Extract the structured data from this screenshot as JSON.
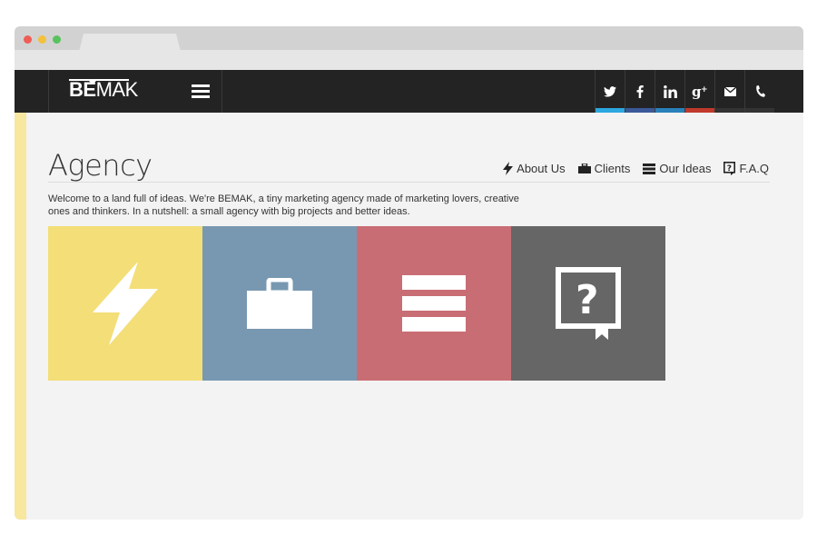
{
  "browser": {
    "window_controls": [
      "close",
      "minimize",
      "maximize"
    ]
  },
  "header": {
    "logo": {
      "be": "BE",
      "mak": "MAK"
    },
    "menu_icon": "hamburger-menu-icon",
    "social": [
      {
        "name": "twitter",
        "icon": "twitter-icon",
        "color": "#2ca7e0"
      },
      {
        "name": "facebook",
        "icon": "facebook-icon",
        "color": "#3b5998"
      },
      {
        "name": "linkedin",
        "icon": "linkedin-icon",
        "color": "#2a80b9"
      },
      {
        "name": "google-plus",
        "icon": "google-plus-icon",
        "color": "#c0392b"
      },
      {
        "name": "email",
        "icon": "mail-icon",
        "color": "#333333"
      },
      {
        "name": "phone",
        "icon": "phone-icon",
        "color": "#333333"
      }
    ]
  },
  "page": {
    "title": "Agency",
    "intro": "Welcome to a land full of ideas. We're BEMAK, a tiny marketing agency made of marketing lovers, creative ones and thinkers. In a nutshell: a small agency with big projects and better ideas.",
    "accent_color": "#f7e79f"
  },
  "subnav": [
    {
      "label": "About Us",
      "icon": "lightning-icon"
    },
    {
      "label": "Clients",
      "icon": "briefcase-icon"
    },
    {
      "label": "Our Ideas",
      "icon": "list-icon"
    },
    {
      "label": "F.A.Q",
      "icon": "question-icon"
    }
  ],
  "tiles": [
    {
      "name": "about",
      "icon": "lightning-icon",
      "color": "#f3de78"
    },
    {
      "name": "clients",
      "icon": "briefcase-icon",
      "color": "#7898b1"
    },
    {
      "name": "ideas",
      "icon": "list-icon",
      "color": "#c96d75"
    },
    {
      "name": "faq",
      "icon": "question-icon",
      "color": "#666666"
    }
  ]
}
